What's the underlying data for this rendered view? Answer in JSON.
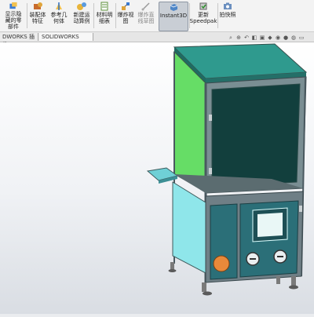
{
  "toolbar": {
    "buttons": [
      {
        "label": "显示隐\n藏的零\n部件",
        "icon": "show-hidden-icon"
      },
      {
        "label": "装配体\n特征",
        "icon": "assembly-feature-icon"
      },
      {
        "label": "参考几\n何体",
        "icon": "reference-geometry-icon"
      },
      {
        "label": "新建运\n动算例",
        "icon": "new-motion-study-icon"
      },
      {
        "label": "材料明\n细表",
        "icon": "bill-of-materials-icon"
      },
      {
        "label": "爆炸视\n图",
        "icon": "exploded-view-icon"
      },
      {
        "label": "爆炸直\n线草图",
        "icon": "explode-line-sketch-icon"
      },
      {
        "label": "Instant3D",
        "icon": "instant3d-icon"
      },
      {
        "label": "更新\nSpeedpak",
        "icon": "update-speedpak-icon"
      },
      {
        "label": "拍快照",
        "icon": "snapshot-icon"
      }
    ]
  },
  "tabs": [
    {
      "label": "DWORKS 插件"
    },
    {
      "label": "SOLIDWORKS MBD"
    }
  ],
  "colors": {
    "teal_panel": "#2c8f86",
    "green_panel": "#66dd66",
    "light_cyan_panel": "#8fe6ea",
    "cabinet_teal": "#2b6f78",
    "dark_window": "#123f3d",
    "frame": "#6f7f86"
  }
}
